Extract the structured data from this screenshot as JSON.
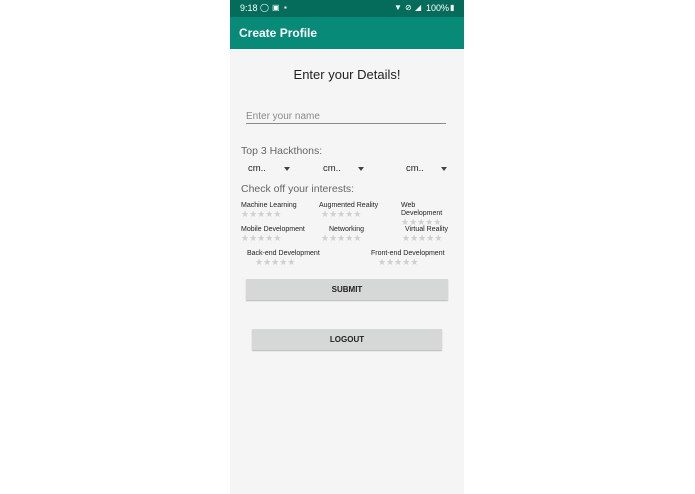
{
  "status_bar": {
    "time": "9:18",
    "battery": "100%"
  },
  "app_bar": {
    "title": "Create Profile"
  },
  "form": {
    "heading": "Enter your Details!",
    "name_placeholder": "Enter your name",
    "hackathons_label": "Top 3 Hackthons:",
    "spinners": [
      "cm..",
      "cm..",
      "cm.."
    ],
    "interests_label": "Check off your interests:",
    "interests": [
      {
        "label": "Machine Learning",
        "rating": 0,
        "max": 5
      },
      {
        "label": "Augmented Reality",
        "rating": 0,
        "max": 5
      },
      {
        "label": "Web Development",
        "rating": 0,
        "max": 5
      },
      {
        "label": "Mobile Development",
        "rating": 0,
        "max": 5
      },
      {
        "label": "Networking",
        "rating": 0,
        "max": 5
      },
      {
        "label": "Virtual Reality",
        "rating": 0,
        "max": 5
      },
      {
        "label": "Back-end Development",
        "rating": 0,
        "max": 5
      },
      {
        "label": "Front-end Development",
        "rating": 0,
        "max": 5
      }
    ],
    "submit_label": "SUBMIT",
    "logout_label": "LOGOUT"
  },
  "colors": {
    "status_bar": "#056b5b",
    "app_bar": "#078a78",
    "button": "#d6d7d7",
    "star_empty": "#cfcfcf"
  }
}
